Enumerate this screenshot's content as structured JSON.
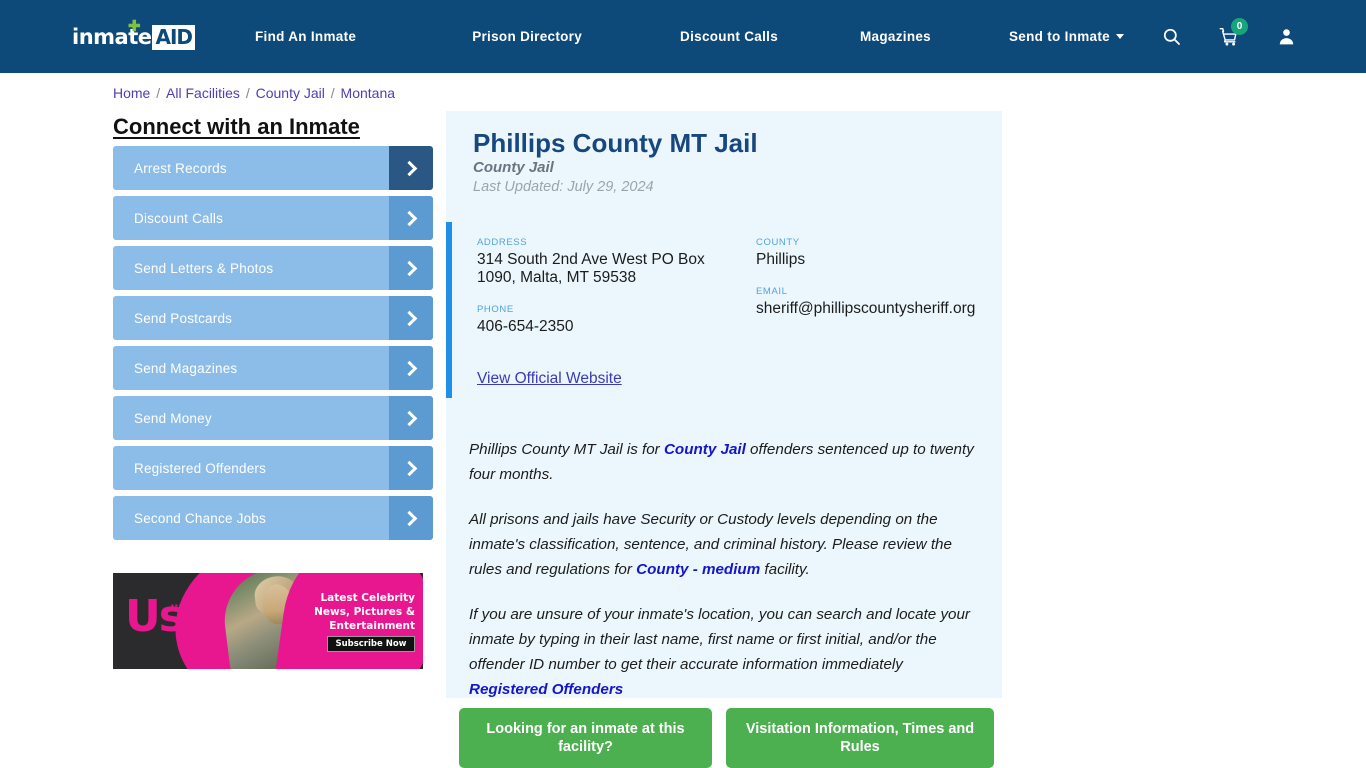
{
  "header": {
    "logo": {
      "word": "inmate",
      "badge": "AID",
      "plus_icon": "plus-icon"
    },
    "nav": [
      {
        "label": "Find An Inmate"
      },
      {
        "label": "Prison Directory"
      },
      {
        "label": "Discount Calls"
      },
      {
        "label": "Magazines"
      },
      {
        "label": "Send to Inmate",
        "has_dropdown": true
      }
    ],
    "icons": {
      "search": "search-icon",
      "cart": "cart-icon",
      "cart_count": "0",
      "account": "user-icon"
    },
    "background_color": "#0d4a7a",
    "badge_color": "#17a67b"
  },
  "breadcrumb": {
    "items": [
      "Home",
      "All Facilities",
      "County Jail",
      "Montana"
    ],
    "separator": "/"
  },
  "sidebar": {
    "title": "Connect with an Inmate",
    "items": [
      {
        "label": "Arrest Records",
        "active": true
      },
      {
        "label": "Discount Calls",
        "active": false
      },
      {
        "label": "Send Letters & Photos",
        "active": false
      },
      {
        "label": "Send Postcards",
        "active": false
      },
      {
        "label": "Send Magazines",
        "active": false
      },
      {
        "label": "Send Money",
        "active": false
      },
      {
        "label": "Registered Offenders",
        "active": false
      },
      {
        "label": "Second Chance Jobs",
        "active": false
      }
    ],
    "item_color": "#8cbde8",
    "chevron_color": "#5b9bd2",
    "chevron_active_color": "#2a5783"
  },
  "advertisement": {
    "brand": "Us",
    "headline": "Latest Celebrity News, Pictures & Entertainment",
    "cta_label": "Subscribe Now",
    "accent_color": "#e8168f"
  },
  "facility": {
    "name": "Phillips County MT Jail",
    "type": "County Jail",
    "last_updated": "Last Updated: July 29, 2024",
    "fields": {
      "address_label": "ADDRESS",
      "address_value": "314 South 2nd Ave West PO Box 1090, Malta, MT 59538",
      "county_label": "COUNTY",
      "county_value": "Phillips",
      "phone_label": "PHONE",
      "phone_value": "406-654-2350",
      "email_label": "EMAIL",
      "email_value": "sheriff@phillipscountysheriff.org"
    },
    "official_website_link": "View Official Website",
    "accent_bar_color": "#1f8fe8",
    "card_background": "#ebf7fd"
  },
  "description": {
    "p1_a": "Phillips County MT Jail is for ",
    "p1_link": "County Jail",
    "p1_b": " offenders sentenced up to twenty four months.",
    "p2_a": "All prisons and jails have Security or Custody levels depending on the inmate's classification, sentence, and criminal history. Please review the rules and regulations for ",
    "p2_link": "County - medium",
    "p2_b": " facility.",
    "p3_a": "If you are unsure of your inmate's location, you can search and locate your inmate by typing in their last name, first name or first initial, and/or the offender ID number to get their accurate information immediately ",
    "p3_link": "Registered Offenders"
  },
  "cta_buttons": {
    "primary": "Looking for an inmate at this facility?",
    "secondary": "Visitation Information, Times and Rules",
    "color": "#4caf50"
  }
}
